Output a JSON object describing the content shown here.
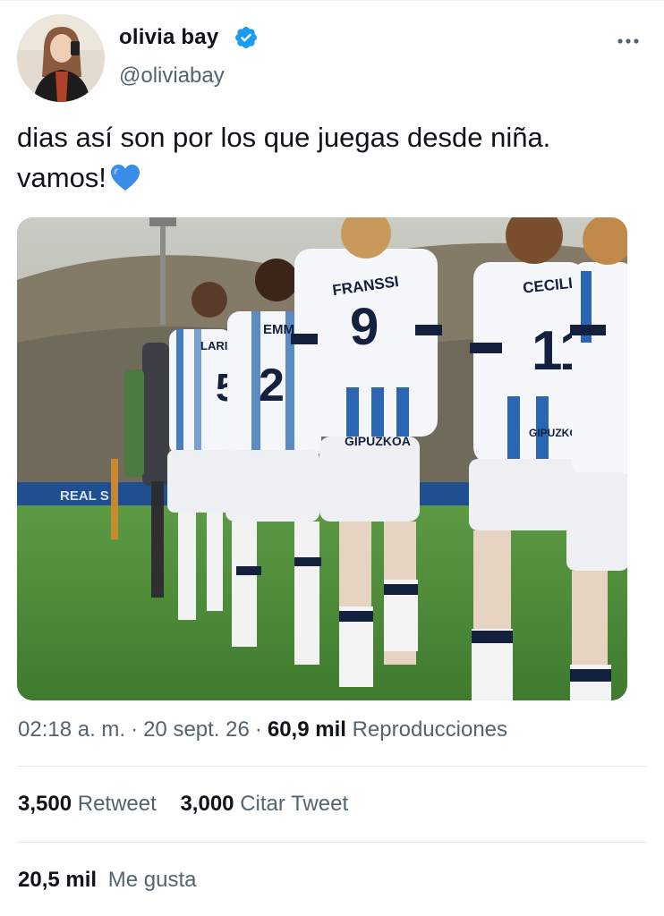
{
  "tweet": {
    "author": {
      "display_name": "olivia bay",
      "handle": "@oliviabay",
      "verified": true,
      "avatar_icon": "avatar-photo"
    },
    "text_line1": "dias así son por los que juegas desde niña.",
    "text_line2": "vamos!",
    "emoji": "blue-heart-icon",
    "media": {
      "jersey_names": [
        "FRANSSI",
        "CECILI",
        "EMM",
        "LARI"
      ],
      "jersey_numbers": [
        "9",
        "11",
        "2",
        "5"
      ],
      "sponsor": "GIPUZKOA",
      "banner_text": "REAL S"
    },
    "timestamp": "02:18 a. m.",
    "date": "20 sept. 26",
    "views_count": "60,9 mil",
    "views_label": "Reproducciones",
    "retweets_count": "3,500",
    "retweets_label": "Retweet",
    "quotes_count": "3,000",
    "quotes_label": "Citar Tweet",
    "likes_count": "20,5 mil",
    "likes_label": "Me gusta"
  },
  "colors": {
    "verified": "#1d9bf0",
    "secondary_text": "#536471",
    "primary_text": "#0f1419",
    "divider": "#e6e9ea",
    "kit_blue": "#1f5fa8",
    "kit_navy": "#13213f"
  }
}
